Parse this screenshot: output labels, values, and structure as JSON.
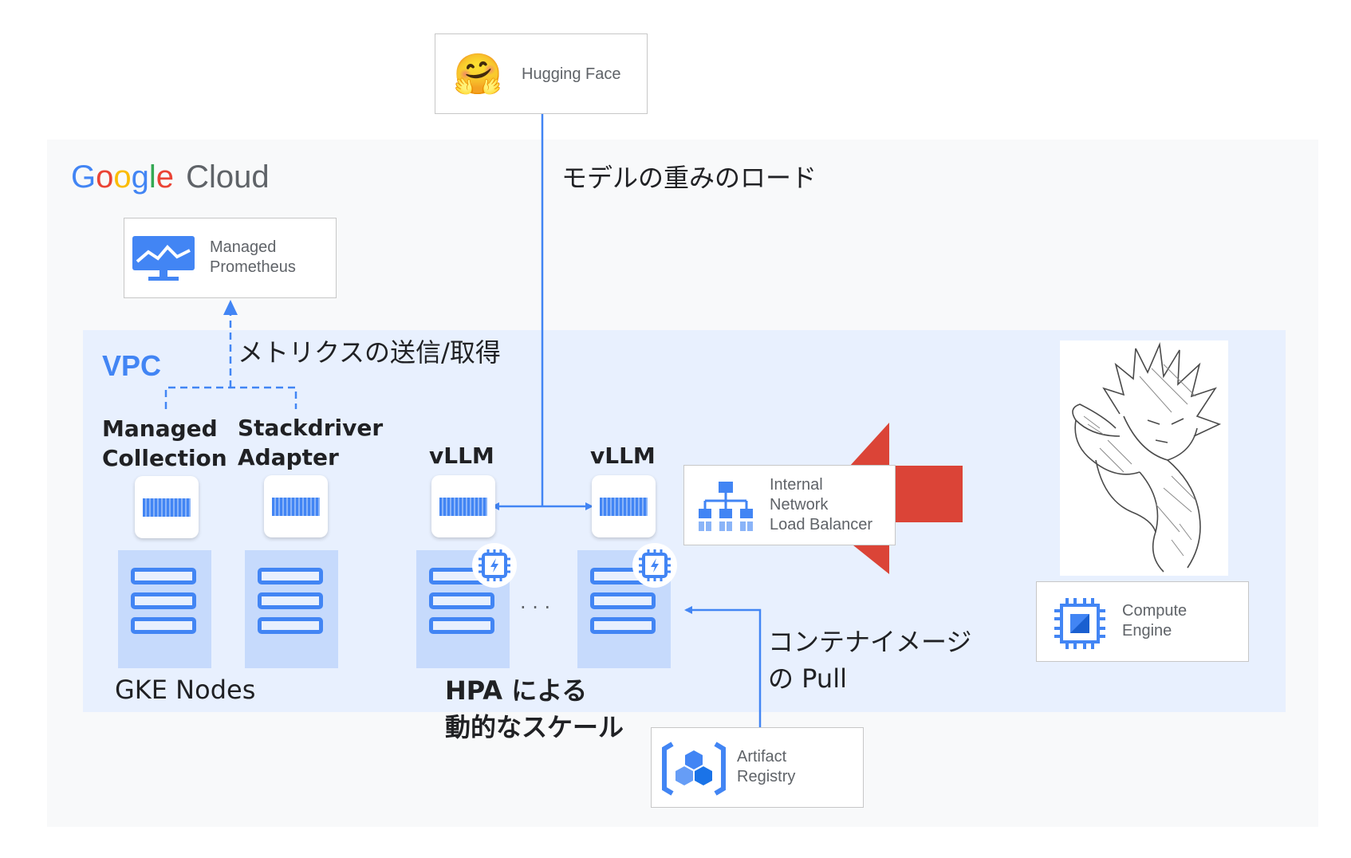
{
  "google_cloud": {
    "logo_google": "Google",
    "logo_cloud": "Cloud",
    "logo_colors": [
      "#4285f4",
      "#ea4335",
      "#fbbc05",
      "#4285f4",
      "#34a853",
      "#ea4335"
    ]
  },
  "hugging_face": {
    "label": "Hugging Face",
    "icon": "hugging-face-emoji",
    "glyph": "🤗"
  },
  "managed_prometheus": {
    "label": "Managed\nPrometheus",
    "icon": "monitor-chart-icon"
  },
  "edges": {
    "weights_load": "モデルの重みのロード",
    "metrics": "メトリクスの送信/取得",
    "image_pull": "コンテナイメージ\nの Pull"
  },
  "vpc": {
    "label": "VPC"
  },
  "components": {
    "managed_collection": "Managed\nCollection",
    "stackdriver_adapter": "Stackdriver\nAdapter",
    "vllm_1": "vLLM",
    "vllm_2": "vLLM"
  },
  "gke_nodes_label": "GKE Nodes",
  "ellipsis": "· · ·",
  "hpa_label": "HPA による\n動的なスケール",
  "load_balancer": {
    "label": "Internal\nNetwork\nLoad Balancer",
    "icon": "load-balancer-icon"
  },
  "compute_engine": {
    "label": "Compute\nEngine",
    "icon": "compute-engine-chip-icon"
  },
  "artifact_registry": {
    "label": "Artifact\nRegistry",
    "icon": "artifact-registry-icon"
  },
  "colors": {
    "accent_blue": "#4285f4",
    "vpc_bg": "#e8f0fe",
    "cloud_bg": "#f8f9fa",
    "node_bg": "#c6dafc",
    "big_arrow": "#db4437"
  }
}
